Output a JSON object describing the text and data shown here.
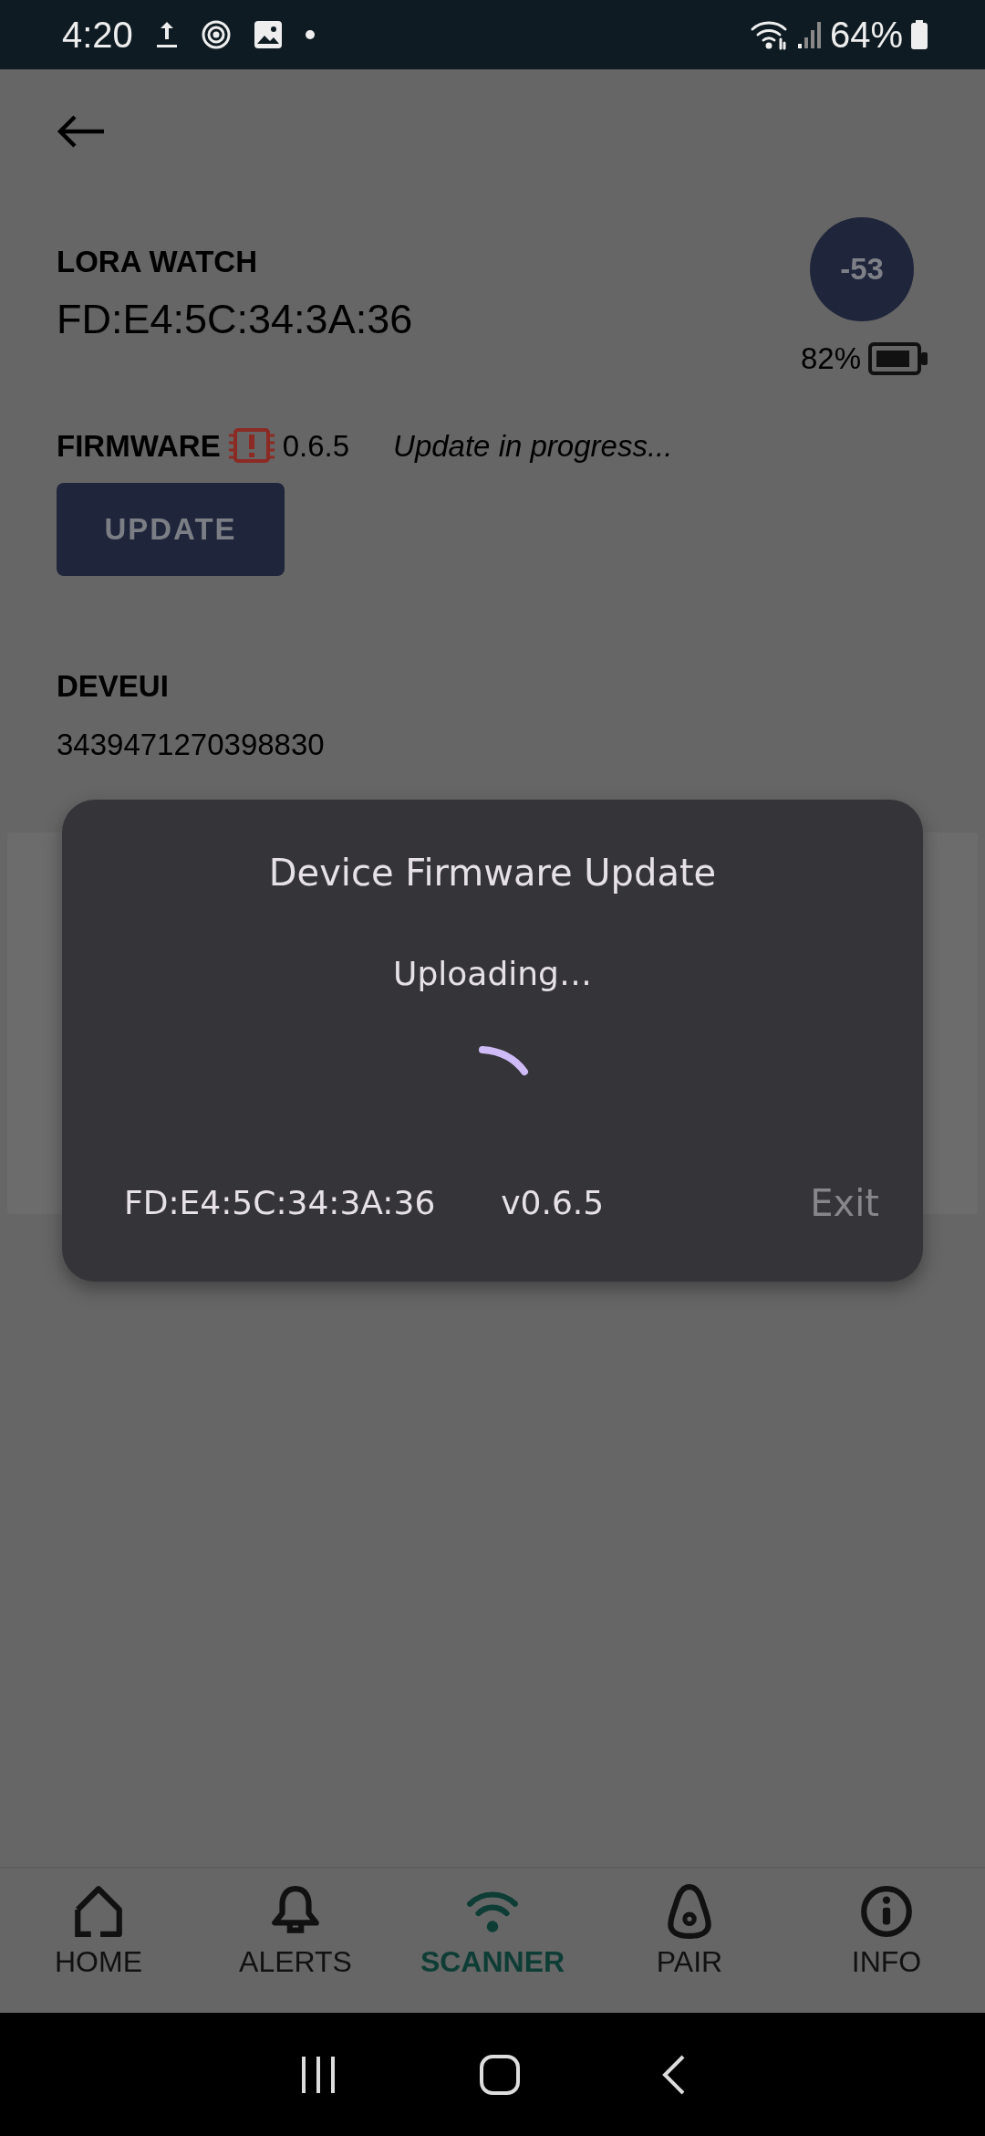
{
  "status_bar": {
    "time": "4:20",
    "battery": "64%"
  },
  "device": {
    "name": "LORA WATCH",
    "mac": "FD:E4:5C:34:3A:36",
    "rssi": "-53",
    "battery": "82%"
  },
  "firmware": {
    "label": "FIRMWARE",
    "version": "0.6.5",
    "status": "Update in progress...",
    "update_button": {
      "label": "UPDATE",
      "disabled": true
    }
  },
  "deveui": {
    "label": "DEVEUI",
    "value": "3439471270398830"
  },
  "dialog": {
    "title": "Device Firmware Update",
    "message": "Uploading…",
    "device": "FD:E4:5C:34:3A:36",
    "version": "v0.6.5",
    "exit_button": {
      "label": "Exit",
      "disabled": true
    }
  },
  "bottom_nav": [
    {
      "kind": "home",
      "label": "HOME",
      "selected": false
    },
    {
      "kind": "alerts",
      "label": "ALERTS",
      "selected": false
    },
    {
      "kind": "scanner",
      "label": "SCANNER",
      "selected": true
    },
    {
      "kind": "pair",
      "label": "PAIR",
      "selected": false
    },
    {
      "kind": "info",
      "label": "INFO",
      "selected": false
    }
  ]
}
